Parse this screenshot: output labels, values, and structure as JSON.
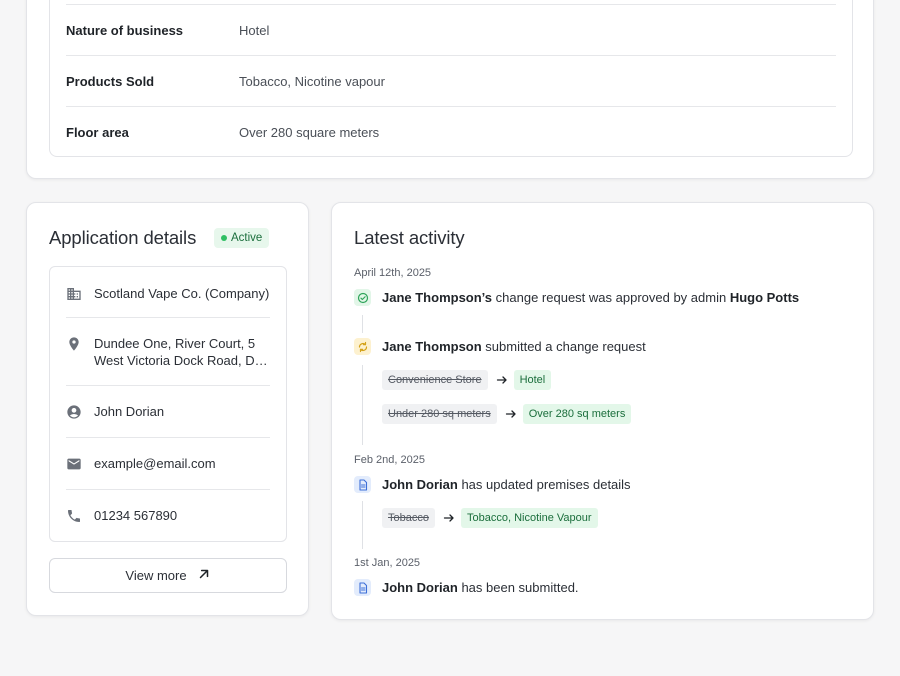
{
  "premises": {
    "rows": [
      {
        "label": "Nature of business",
        "value": "Hotel"
      },
      {
        "label": "Products Sold",
        "value": "Tobacco, Nicotine vapour"
      },
      {
        "label": "Floor area",
        "value": "Over 280 square meters"
      }
    ]
  },
  "application": {
    "title": "Application details",
    "status": "Active",
    "company": "Scotland Vape Co. (Company)",
    "address_line1": "Dundee One, River Court, 5",
    "address_line2": "West Victoria Dock Road, Dundee",
    "contact_name": "John Dorian",
    "email": "example@email.com",
    "phone": "01234 567890",
    "view_more_label": "View more"
  },
  "activity": {
    "title": "Latest activity",
    "groups": [
      {
        "date": "April 12th, 2025",
        "events": [
          {
            "actor": "Jane Thompson’s",
            "text": " change request was approved by admin ",
            "target": "Hugo Potts"
          },
          {
            "actor": "Jane Thompson",
            "text": " submitted a change request",
            "changes": [
              {
                "from": "Convenience Store",
                "to": "Hotel"
              },
              {
                "from": "Under 280 sq meters",
                "to": "Over 280 sq meters"
              }
            ]
          }
        ]
      },
      {
        "date": "Feb 2nd, 2025",
        "events": [
          {
            "actor": "John Dorian",
            "text": " has updated premises details",
            "changes": [
              {
                "from": "Tobacco",
                "to": "Tobacco, Nicotine Vapour"
              }
            ]
          }
        ]
      },
      {
        "date": "1st Jan, 2025",
        "events": [
          {
            "actor": "John Dorian",
            "text": " has been submitted."
          }
        ]
      }
    ]
  },
  "colors": {
    "success": "#2fbf63",
    "success_bg": "#e3f7e9",
    "warning_bg": "#fdf1cf",
    "info_bg": "#e3ecfc"
  },
  "icons": [
    "building-icon",
    "location-pin-icon",
    "user-circle-icon",
    "mail-icon",
    "phone-icon",
    "arrow-up-right-icon",
    "check-circle-icon",
    "sync-icon",
    "document-icon",
    "arrow-right-icon"
  ]
}
